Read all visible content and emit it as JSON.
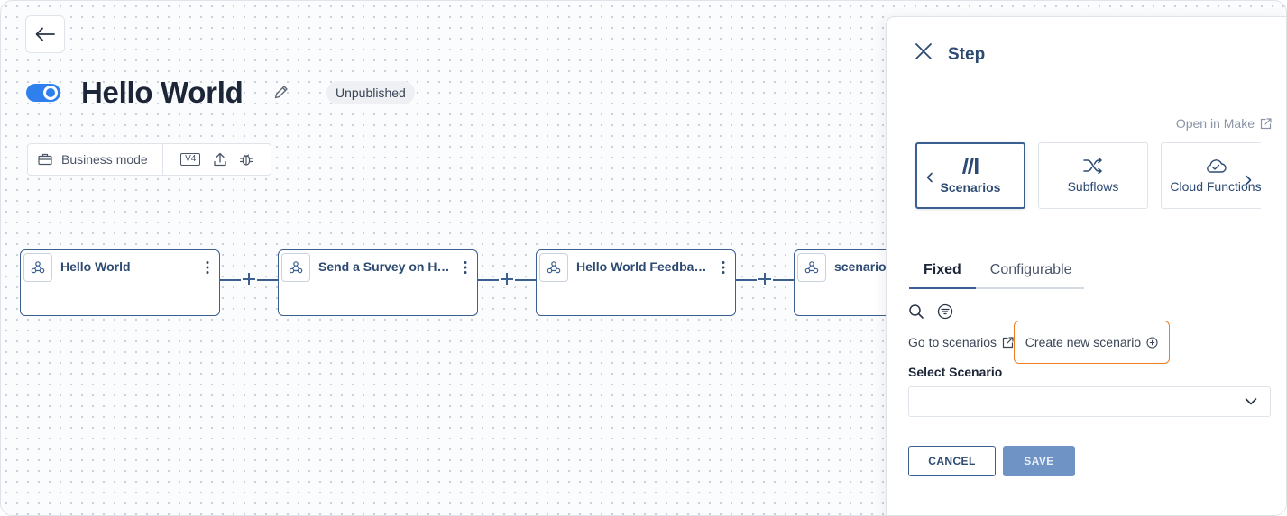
{
  "header": {
    "title": "Hello World",
    "status": "Unpublished",
    "toggle_on": true
  },
  "toolbar": {
    "mode_label": "Business mode",
    "version_label": "V4",
    "icons": [
      "briefcase-icon",
      "upload-icon",
      "bug-icon"
    ]
  },
  "flow": {
    "nodes": [
      {
        "title": "Hello World",
        "icon": "webhook-icon"
      },
      {
        "title": "Send a Survey on Hell...",
        "icon": "webhook-icon"
      },
      {
        "title": "Hello World Feedback...",
        "icon": "webhook-icon"
      },
      {
        "title": "scenario",
        "icon": "webhook-icon"
      }
    ]
  },
  "panel": {
    "title": "Step",
    "open_in_make": "Open in Make",
    "cards": [
      {
        "label": "Scenarios",
        "icon": "make-logo-icon",
        "active": true
      },
      {
        "label": "Subflows",
        "icon": "shuffle-icon",
        "active": false
      },
      {
        "label": "Cloud Functions",
        "icon": "cloud-icon",
        "active": false
      }
    ],
    "tabs": [
      {
        "label": "Fixed",
        "active": true
      },
      {
        "label": "Configurable",
        "active": false
      }
    ],
    "go_to_scenarios": "Go to scenarios",
    "create_new_scenario": "Create new scenario",
    "select_label": "Select Scenario",
    "select_value": "",
    "cancel_label": "CANCEL",
    "save_label": "SAVE"
  },
  "colors": {
    "accent": "#3b5f8f",
    "toggle": "#2f80ed",
    "highlight": "#f07f24",
    "save_bg": "#6f93c5"
  }
}
